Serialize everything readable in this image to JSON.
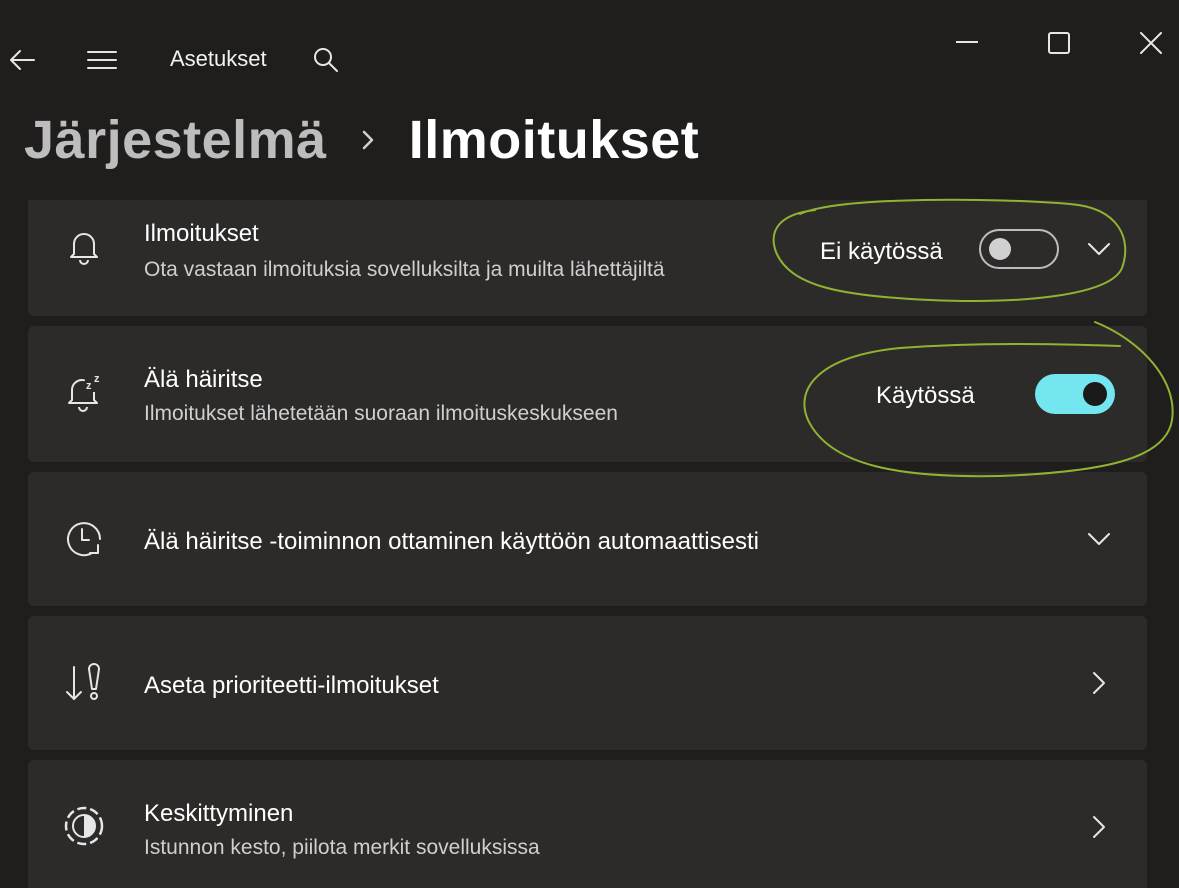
{
  "window": {
    "app_title": "Asetukset",
    "back_icon": "back-arrow-icon",
    "menu_icon": "hamburger-menu-icon",
    "search_icon": "search-icon",
    "minimize_icon": "minimize-icon",
    "maximize_icon": "maximize-icon",
    "close_icon": "close-icon"
  },
  "breadcrumb": {
    "parent": "Järjestelmä",
    "separator_icon": "chevron-right-icon",
    "current": "Ilmoitukset"
  },
  "settings": [
    {
      "icon": "bell-icon",
      "title": "Ilmoitukset",
      "subtitle": "Ota vastaan ilmoituksia sovelluksilta ja muilta lähettäjiltä",
      "state_label": "Ei käytössä",
      "toggle_on": false,
      "trailing": "chevron-down-icon"
    },
    {
      "icon": "bell-snooze-icon",
      "title": "Älä häiritse",
      "subtitle": "Ilmoitukset lähetetään suoraan ilmoituskeskukseen",
      "state_label": "Käytössä",
      "toggle_on": true
    },
    {
      "icon": "clock-auto-icon",
      "title": "Älä häiritse -toiminnon ottaminen käyttöön automaattisesti",
      "trailing": "chevron-down-icon"
    },
    {
      "icon": "priority-notifications-icon",
      "title": "Aseta prioriteetti-ilmoitukset",
      "trailing": "chevron-right-icon"
    },
    {
      "icon": "focus-icon",
      "title": "Keskittyminen",
      "subtitle": "Istunnon kesto, piilota merkit sovelluksissa",
      "trailing": "chevron-right-icon"
    }
  ],
  "colors": {
    "background": "#1f1e1d",
    "card": "#2c2b2a",
    "accent": "#74e6f0",
    "annotation": "#8fb431"
  }
}
